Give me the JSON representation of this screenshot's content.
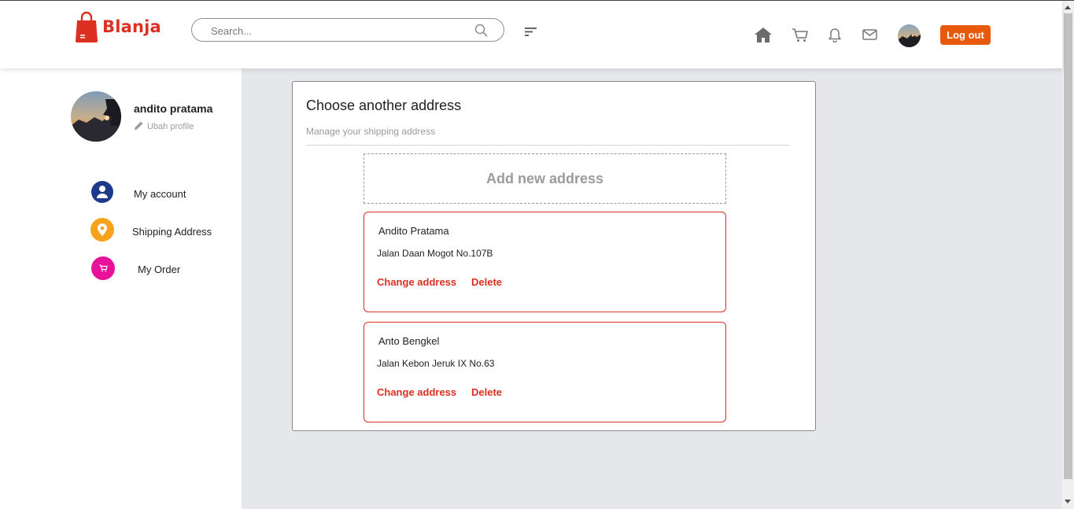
{
  "brand": {
    "name": "Blanja",
    "color": "#db3022"
  },
  "header": {
    "search_placeholder": "Search...",
    "icons": [
      "search-icon",
      "filter-icon",
      "home-icon",
      "cart-icon",
      "bell-icon",
      "mail-icon"
    ],
    "logout_label": "Log out",
    "logout_color": "#e8590c"
  },
  "sidebar": {
    "profile_name": "andito pratama",
    "edit_profile": "Ubah profile",
    "menu": [
      {
        "label": "My account",
        "icon": "user-icon",
        "color": "#273ac7"
      },
      {
        "label": "Shipping Address",
        "icon": "map-pin-icon",
        "color": "#f36f21"
      },
      {
        "label": "My Order",
        "icon": "cart-icon",
        "color": "#f3456f"
      }
    ]
  },
  "main": {
    "title": "Choose another address",
    "subtitle": "Manage your shipping address",
    "add_label": "Add new address",
    "addresses": [
      {
        "name": "Andito Pratama",
        "line": "Jalan Daan Mogot No.107B",
        "change_label": "Change address",
        "delete_label": "Delete"
      },
      {
        "name": "Anto Bengkel",
        "line": "Jalan Kebon Jeruk IX No.63",
        "change_label": "Change address",
        "delete_label": "Delete"
      }
    ]
  }
}
